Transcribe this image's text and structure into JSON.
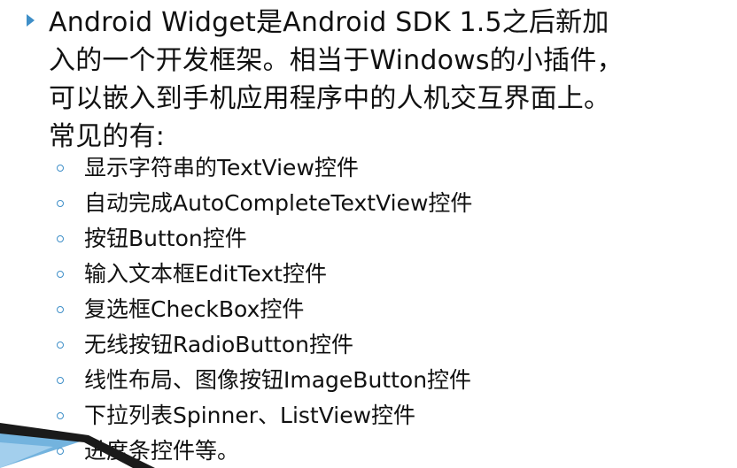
{
  "paragraph": {
    "lines": [
      "Android Widget是Android SDK 1.5之后新加",
      "入的一个开发框架。相当于Windows的小插件，",
      "可以嵌入到手机应用程序中的人机交互界面上。",
      "常见的有:"
    ]
  },
  "items": [
    "显示字符串的TextView控件",
    "自动完成AutoCompleteTextView控件",
    "按钮Button控件",
    "输入文本框EditText控件",
    "复选框CheckBox控件",
    "无线按钮RadioButton控件",
    "线性布局、图像按钮ImageButton控件",
    "下拉列表Spinner、ListView控件",
    "进度条控件等。"
  ],
  "colors": {
    "accent": "#3f8fc8",
    "text": "#111111",
    "decoration_dark": "#1a1a1a",
    "decoration_blue": "#5aa6d8"
  }
}
